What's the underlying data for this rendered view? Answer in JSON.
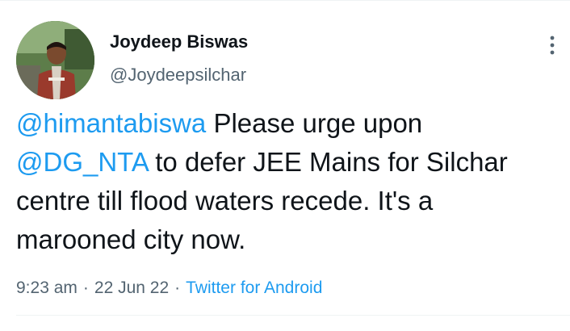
{
  "tweet": {
    "author": {
      "display_name": "Joydeep Biswas",
      "handle": "@Joydeepsilchar"
    },
    "text": {
      "mention1": "@himantabiswa",
      "segment1": " Please urge upon ",
      "mention2": "@DG_NTA",
      "segment2": " to defer JEE Mains for Silchar centre till flood waters recede. It's a marooned city now."
    },
    "meta": {
      "time": "9:23 am",
      "separator": "·",
      "date": "22 Jun 22",
      "source": "Twitter for Android"
    },
    "icons": {
      "more": "more-options-icon",
      "avatar": "avatar-photo"
    },
    "colors": {
      "link": "#1d9bf0",
      "secondary_text": "#536471",
      "primary_text": "#0f1419"
    }
  }
}
